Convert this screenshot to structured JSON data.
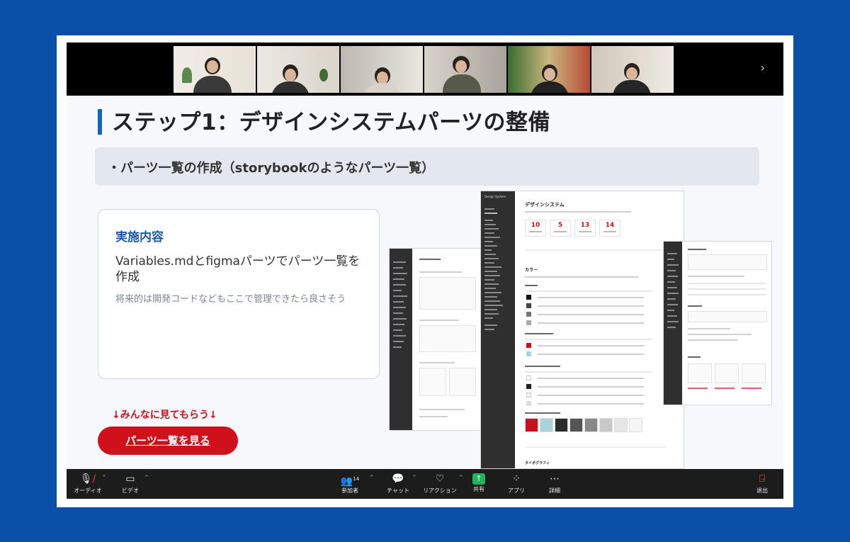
{
  "slide": {
    "title": "ステップ1：デザインシステムパーツの整備",
    "bullet": "・パーツ一覧の作成（storybookのようなパーツ一覧）",
    "card": {
      "heading": "実施内容",
      "main": "Variables.mdとfigmaパーツでパーツ一覧を作成",
      "sub": "将来的は開発コードなどもここで管理できたら良さそう"
    },
    "cta_note": "↓みんなに見てもらう↓",
    "cta_button": "パーツ一覧を見る"
  },
  "design_system_preview": {
    "sidebar_title": "Design System",
    "page_title": "デザインシステム",
    "stats": [
      "10",
      "5",
      "13",
      "14"
    ],
    "section_title": "カラー",
    "bottom_section": "タイポグラフィ",
    "palette_colors": [
      "#c8101e",
      "#a8d4da",
      "#2b2b2b",
      "#555555",
      "#888888",
      "#c9c9c9",
      "#e6e6e6",
      "#f5f5f5"
    ]
  },
  "meeting_toolbar": {
    "audio": "オーディオ",
    "video": "ビデオ",
    "participants": "参加者",
    "participants_count": "14",
    "chat": "チャット",
    "reactions": "リアクション",
    "share": "共有",
    "apps": "アプリ",
    "more": "詳細",
    "leave": "退出"
  },
  "icons": {
    "mic": "mic-muted-icon",
    "video": "video-camera-icon",
    "participants": "people-icon",
    "chat": "chat-bubble-icon",
    "reactions": "heart-icon",
    "share": "share-arrow-icon",
    "apps": "apps-icon",
    "more": "more-dots-icon",
    "leave": "exit-door-icon",
    "next": "chevron-right-icon"
  },
  "colors": {
    "accent_blue": "#1565c0",
    "accent_red": "#d0111b",
    "share_green": "#21b45a",
    "active_speaker": "#2ecc40"
  }
}
